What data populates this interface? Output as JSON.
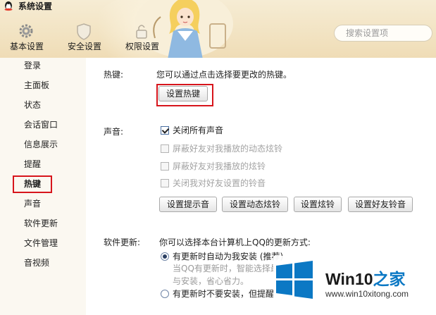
{
  "window": {
    "title": "系统设置"
  },
  "header": {
    "tabs": [
      {
        "label": "基本设置",
        "icon": "gear-icon"
      },
      {
        "label": "安全设置",
        "icon": "shield-icon"
      },
      {
        "label": "权限设置",
        "icon": "lock-icon"
      }
    ],
    "search": {
      "placeholder": "搜索设置项"
    }
  },
  "sidebar": {
    "items": [
      {
        "label": "登录"
      },
      {
        "label": "主面板"
      },
      {
        "label": "状态"
      },
      {
        "label": "会话窗口"
      },
      {
        "label": "信息展示"
      },
      {
        "label": "提醒"
      },
      {
        "label": "热键",
        "selected": true
      },
      {
        "label": "声音"
      },
      {
        "label": "软件更新"
      },
      {
        "label": "文件管理"
      },
      {
        "label": "音视频"
      }
    ]
  },
  "hotkey": {
    "label": "热键:",
    "description": "您可以通过点击选择要更改的热键。",
    "button": "设置热键"
  },
  "sound": {
    "label": "声音:",
    "options": [
      {
        "label": "关闭所有声音",
        "checked": true,
        "enabled": true
      },
      {
        "label": "屏蔽好友对我播放的动态炫铃",
        "checked": false,
        "enabled": false
      },
      {
        "label": "屏蔽好友对我播放的炫铃",
        "checked": false,
        "enabled": false
      },
      {
        "label": "关闭我对好友设置的铃音",
        "checked": false,
        "enabled": false
      }
    ],
    "buttons": [
      "设置提示音",
      "设置动态炫铃",
      "设置炫铃",
      "设置好友铃音"
    ]
  },
  "update": {
    "label": "软件更新:",
    "description": "你可以选择本台计算机上QQ的更新方式:",
    "options": [
      {
        "label": "有更新时自动为我安装 (推荐)",
        "selected": true
      },
      {
        "label": "有更新时不要安装，但提醒",
        "selected": false
      }
    ],
    "hint_line1": "当QQ有更新时，智能选择最",
    "hint_line2": "与安装，省心省力。"
  },
  "watermark": {
    "title_main": "Win10",
    "title_accent": "之家",
    "url": "www.win10xitong.com"
  },
  "colors": {
    "highlight_box": "#d7151c",
    "header_bg": "#f2e3c2",
    "sidebar_bg": "#fbf8f1",
    "win_blue": "#0b78c4"
  }
}
